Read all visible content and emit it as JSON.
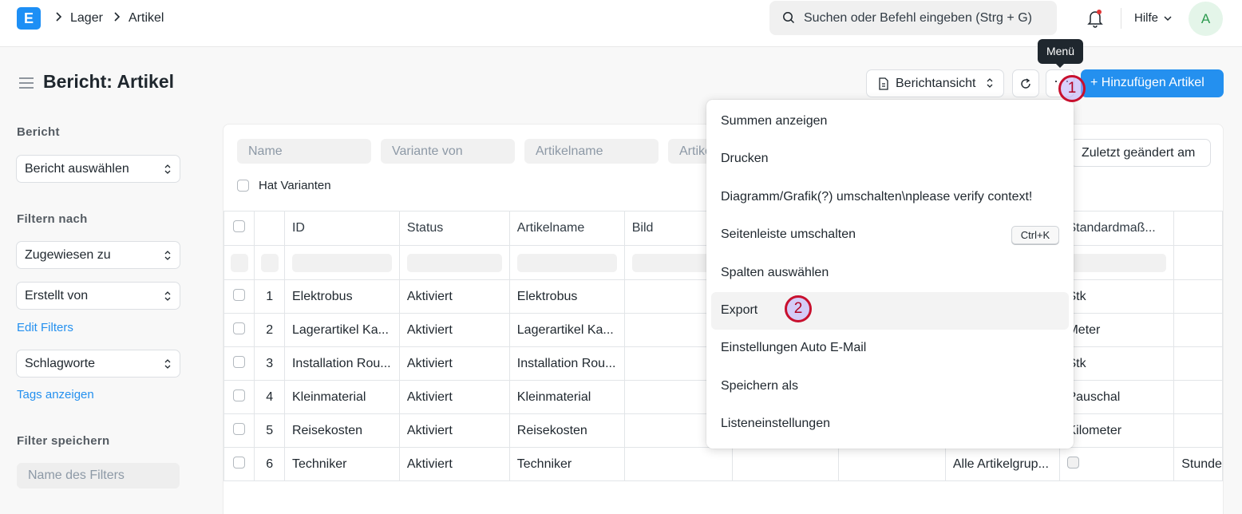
{
  "navbar": {
    "logo_letter": "E",
    "breadcrumbs": [
      "Lager",
      "Artikel"
    ],
    "search_placeholder": "Suchen oder Befehl eingeben (Strg + G)",
    "help_label": "Hilfe",
    "avatar_initial": "A"
  },
  "page": {
    "title": "Bericht: Artikel",
    "view_button": "Berichtansicht",
    "menu_tooltip": "Menü",
    "primary_button": "+ Hinzufügen Artikel"
  },
  "annotations": [
    "1",
    "2"
  ],
  "sidebar": {
    "report_heading": "Bericht",
    "report_select": "Bericht auswählen",
    "filter_heading": "Filtern nach",
    "assigned_to": "Zugewiesen zu",
    "created_by": "Erstellt von",
    "edit_filters": "Edit Filters",
    "tags": "Schlagworte",
    "show_tags": "Tags anzeigen",
    "save_filter_heading": "Filter speichern",
    "filter_name_placeholder": "Name des Filters"
  },
  "filters": {
    "name": "Name",
    "variant_of": "Variante von",
    "item_name": "Artikelname",
    "item_group": "Artikelgruppe",
    "has_variants": "Hat Varianten",
    "sort": "Zuletzt geändert am"
  },
  "table": {
    "columns": [
      "ID",
      "Status",
      "Artikelname",
      "Bild",
      "",
      "",
      "",
      "Standardmaß..."
    ],
    "rows": [
      {
        "num": "1",
        "id": "Elektrobus",
        "status": "Aktiviert",
        "name": "Elektrobus",
        "group": "",
        "uom": "Stk"
      },
      {
        "num": "2",
        "id": "Lagerartikel Ka...",
        "status": "Aktiviert",
        "name": "Lagerartikel Ka...",
        "group": "",
        "uom": "Meter"
      },
      {
        "num": "3",
        "id": "Installation Rou...",
        "status": "Aktiviert",
        "name": "Installation Rou...",
        "group": "",
        "uom": "Stk"
      },
      {
        "num": "4",
        "id": "Kleinmaterial",
        "status": "Aktiviert",
        "name": "Kleinmaterial",
        "group": "",
        "uom": "Pauschal"
      },
      {
        "num": "5",
        "id": "Reisekosten",
        "status": "Aktiviert",
        "name": "Reisekosten",
        "group": "",
        "uom": "Kilometer"
      },
      {
        "num": "6",
        "id": "Techniker",
        "status": "Aktiviert",
        "name": "Techniker",
        "group": "Alle Artikelgrup...",
        "uom": "Stunde"
      }
    ]
  },
  "menu": {
    "items": [
      {
        "label": "Summen anzeigen"
      },
      {
        "label": "Drucken"
      },
      {
        "label": "Diagramm/Grafik(?) umschalten\\nplease verify context!"
      },
      {
        "label": "Seitenleiste umschalten",
        "shortcut": "Ctrl+K"
      },
      {
        "label": "Spalten auswählen"
      },
      {
        "label": "Export"
      },
      {
        "label": "Einstellungen Auto E-Mail"
      },
      {
        "label": "Speichern als"
      },
      {
        "label": "Listeneinstellungen"
      }
    ]
  },
  "colors": {
    "primary": "#2490ef",
    "annotation_ring": "#c8102e"
  }
}
